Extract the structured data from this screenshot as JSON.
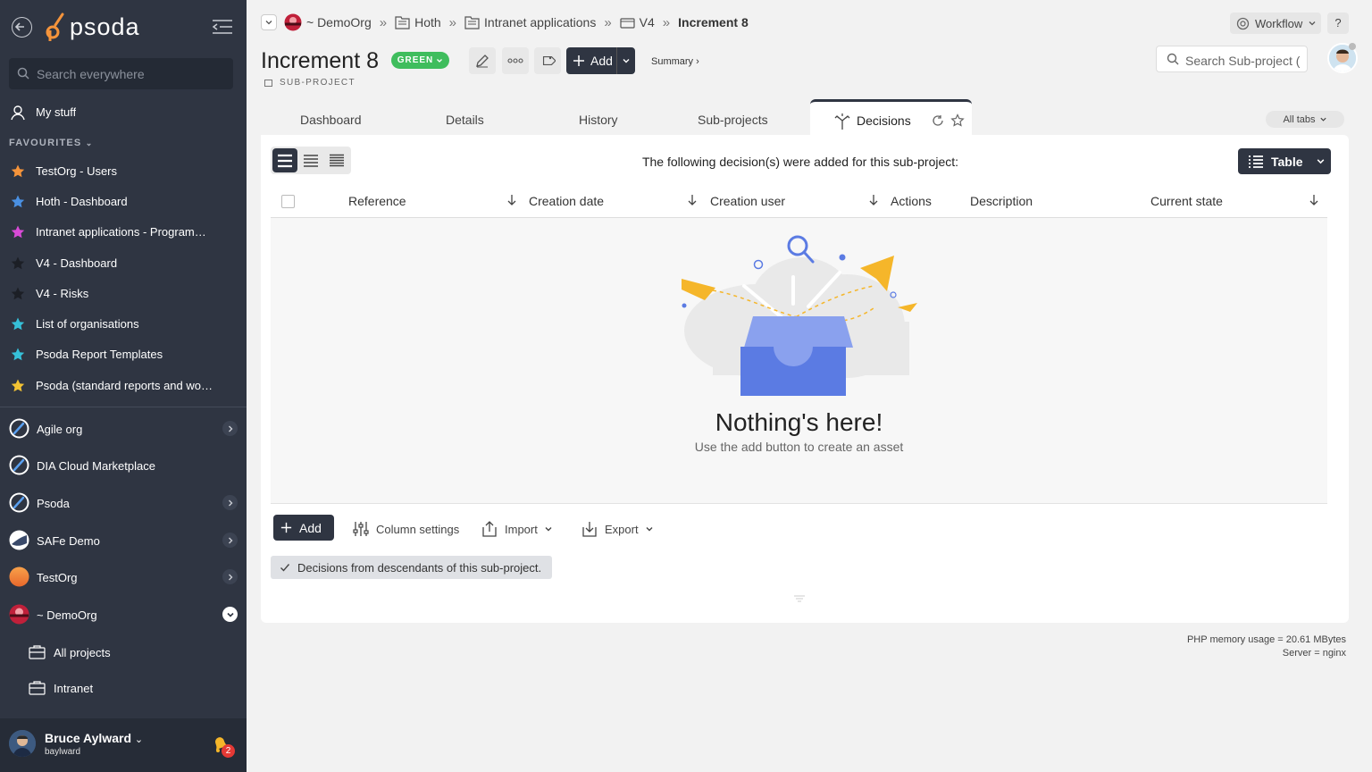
{
  "sidebar": {
    "logo": "psoda",
    "search_placeholder": "Search everywhere",
    "my_stuff": "My stuff",
    "favourites_heading": "FAVOURITES",
    "favourites": [
      {
        "label": "TestOrg - Users",
        "color": "#f5943b"
      },
      {
        "label": "Hoth - Dashboard",
        "color": "#4a90e2"
      },
      {
        "label": "Intranet applications - Programme…",
        "color": "#d84bd6"
      },
      {
        "label": "V4 - Dashboard",
        "color": "#1c1f26"
      },
      {
        "label": "V4 - Risks",
        "color": "#1c1f26"
      },
      {
        "label": "List of organisations",
        "color": "#36c0d8"
      },
      {
        "label": "Psoda Report Templates",
        "color": "#36c0d8"
      },
      {
        "label": "Psoda (standard reports and work…",
        "color": "#f2c233"
      }
    ],
    "orgs": [
      {
        "label": "Agile org"
      },
      {
        "label": "DIA Cloud Marketplace"
      },
      {
        "label": "Psoda"
      },
      {
        "label": "SAFe Demo"
      },
      {
        "label": "TestOrg"
      },
      {
        "label": "~ DemoOrg"
      }
    ],
    "sub_items": [
      {
        "label": "All projects"
      },
      {
        "label": "Intranet"
      }
    ],
    "user": {
      "name": "Bruce Aylward",
      "username": "baylward",
      "notifications": "2"
    }
  },
  "breadcrumbs": [
    {
      "label": "~ DemoOrg"
    },
    {
      "label": "Hoth"
    },
    {
      "label": "Intranet applications"
    },
    {
      "label": "V4"
    },
    {
      "label": "Increment 8"
    }
  ],
  "breadcrumb_sep": "»",
  "header": {
    "title": "Increment 8",
    "rag_status": "GREEN",
    "subtitle": "SUB-PROJECT",
    "add_label": "Add",
    "summary_link": "Summary ›",
    "search_placeholder": "Search Sub-project (",
    "workflow": "Workflow",
    "help": "?"
  },
  "tabs": {
    "items": [
      "Dashboard",
      "Details",
      "History",
      "Sub-projects"
    ],
    "active": "Decisions",
    "all_tabs": "All tabs"
  },
  "decisions": {
    "notice": "The following decision(s) were added for this sub-project:",
    "view_label": "Table",
    "columns": [
      "Reference",
      "Creation date",
      "Creation user",
      "Actions",
      "Description",
      "Current state"
    ],
    "empty_title": "Nothing's here!",
    "empty_sub": "Use the add button to create an asset",
    "footer": {
      "add": "Add",
      "column_settings": "Column settings",
      "import": "Import",
      "export": "Export"
    },
    "descendants_filter": "Decisions from descendants of this sub-project."
  },
  "footer_info": {
    "memory": "PHP memory usage = 20.61 MBytes",
    "server": "Server = nginx"
  },
  "colors": {
    "sidebar_bg": "#2f3542",
    "accent_dark": "#2f3542",
    "rag_green": "#3fbd5d",
    "badge_red": "#e53935",
    "illustration_blue": "#5b7be3",
    "illustration_yellow": "#f5b62a"
  }
}
